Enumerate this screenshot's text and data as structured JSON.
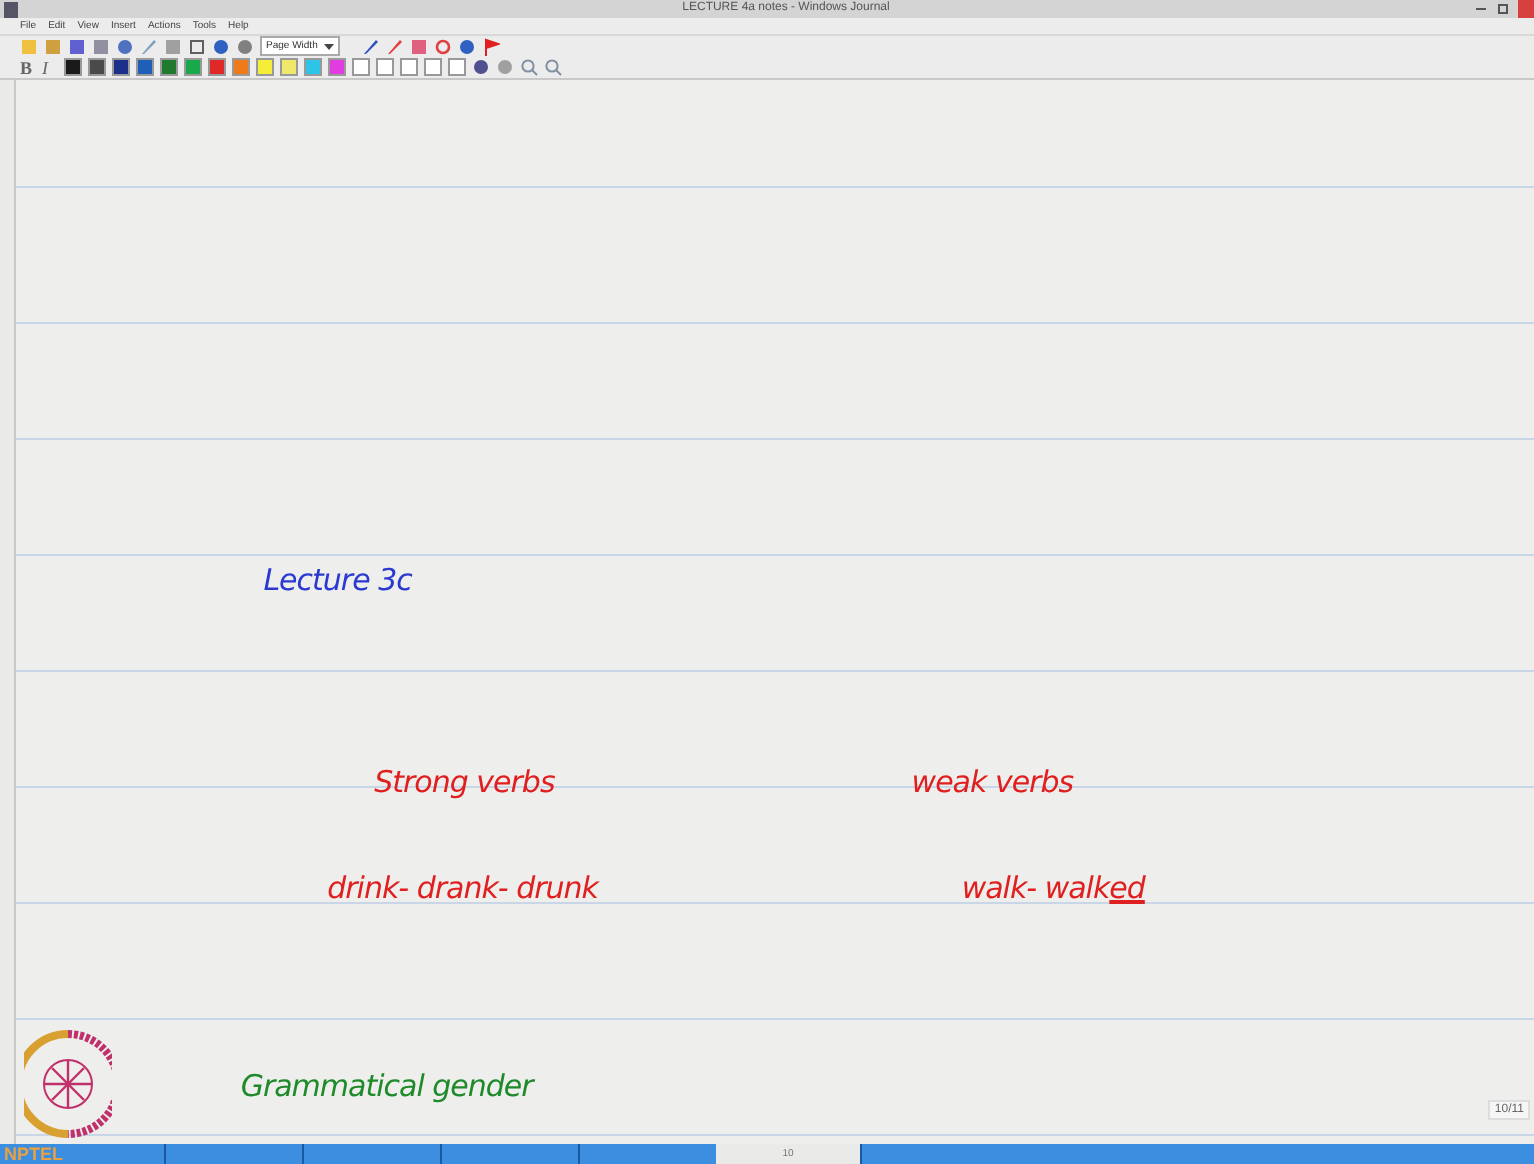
{
  "window": {
    "title": "LECTURE 4a notes - Windows Journal"
  },
  "menu": [
    "File",
    "Edit",
    "View",
    "Insert",
    "Actions",
    "Tools",
    "Help"
  ],
  "toolbar": {
    "zoom_dropdown": "Page Width"
  },
  "format_bar": {
    "bold": "B",
    "italic": "I",
    "swatches": [
      {
        "color": "#1a1a1a"
      },
      {
        "color": "#4a4a4a"
      },
      {
        "color": "#1c2f8a"
      },
      {
        "color": "#1f5fb8"
      },
      {
        "color": "#1f7a2e"
      },
      {
        "color": "#19a84a"
      },
      {
        "color": "#e02828"
      },
      {
        "color": "#f07a1a"
      },
      {
        "color": "#f4ee3a"
      },
      {
        "color": "#f0e86a"
      },
      {
        "color": "#2ec4e8"
      },
      {
        "color": "#e03ce0"
      },
      {
        "color": "#ffffff"
      },
      {
        "color": "#ffffff"
      },
      {
        "color": "#ffffff"
      },
      {
        "color": "#ffffff"
      },
      {
        "color": "#ffffff"
      }
    ]
  },
  "notes": [
    {
      "color": "#2a3ad0",
      "parts": [
        {
          "text": "Lecture 3c",
          "underlined": false
        }
      ]
    },
    {
      "color": "#e02020",
      "parts": [
        {
          "text": "Strong verbs",
          "underlined": false
        }
      ]
    },
    {
      "color": "#e02020",
      "parts": [
        {
          "text": "weak verbs",
          "underlined": false
        }
      ]
    },
    {
      "color": "#e02020",
      "parts": [
        {
          "text": "drink- drank- drunk",
          "underlined": false
        }
      ]
    },
    {
      "color": "#e02020",
      "parts": [
        {
          "text": "walk- walk",
          "underlined": false
        },
        {
          "text": "ed",
          "underlined": true
        }
      ]
    },
    {
      "color": "#1f8a2a",
      "parts": [
        {
          "text": "Grammatical gender",
          "underlined": false
        }
      ]
    }
  ],
  "page_badge": "10/11",
  "status_bar": {
    "logo_text": "NPTEL",
    "page": "10"
  }
}
